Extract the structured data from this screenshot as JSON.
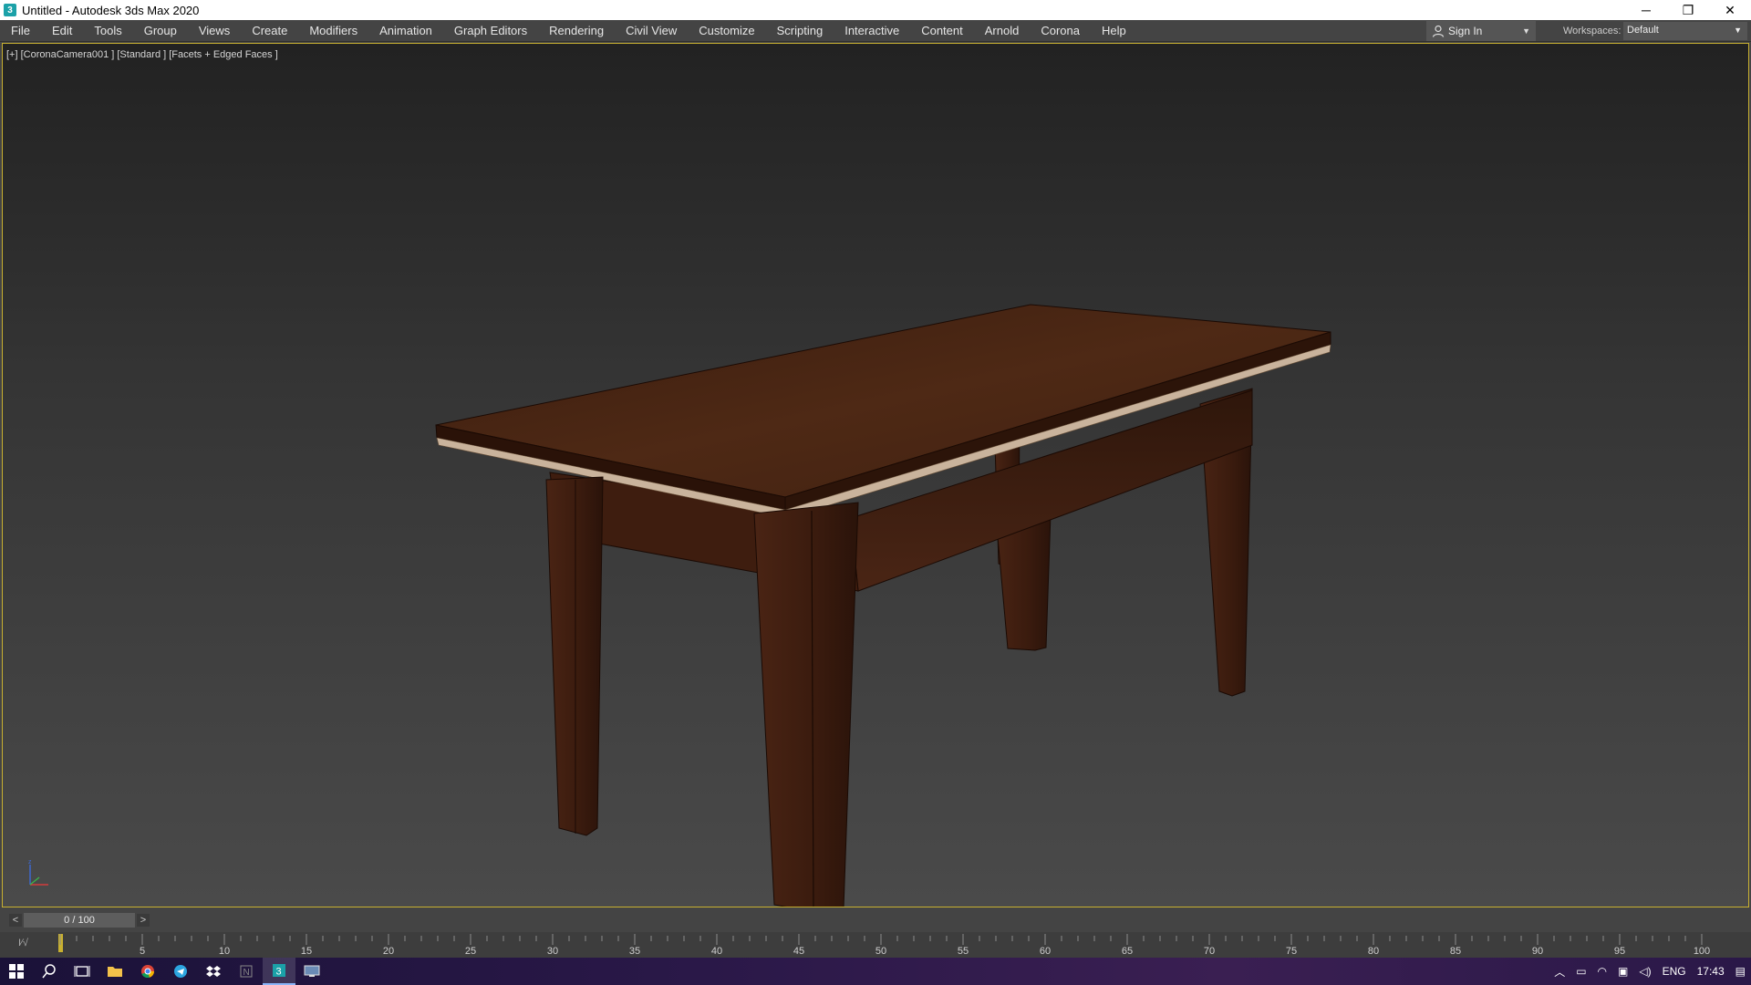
{
  "window": {
    "title": "Untitled - Autodesk 3ds Max 2020",
    "app_icon": "3",
    "controls": {
      "minimize": "─",
      "restore": "❐",
      "close": "✕"
    }
  },
  "menu": [
    "File",
    "Edit",
    "Tools",
    "Group",
    "Views",
    "Create",
    "Modifiers",
    "Animation",
    "Graph Editors",
    "Rendering",
    "Civil View",
    "Customize",
    "Scripting",
    "Interactive",
    "Content",
    "Arnold",
    "Corona",
    "Help"
  ],
  "account": {
    "sign_in_label": "Sign In",
    "caret": "▼"
  },
  "workspace": {
    "label": "Workspaces:",
    "value": "Default",
    "caret": "▼"
  },
  "viewport": {
    "label": "[+] [CoronaCamera001 ] [Standard ] [Facets + Edged Faces ]",
    "scene_object": "wooden-table",
    "border_color": "#c8b030"
  },
  "time_slider": {
    "value": "0 / 100",
    "prev": "<",
    "next": ">"
  },
  "track_bar": {
    "curve_icon": "I∕√",
    "ticks": [
      "5",
      "10",
      "15",
      "20",
      "25",
      "30",
      "35",
      "40",
      "45",
      "50",
      "55",
      "60",
      "65",
      "70",
      "75",
      "80",
      "85",
      "90",
      "95",
      "100"
    ]
  },
  "taskbar": {
    "icons": [
      "windows-start-icon",
      "search-icon",
      "task-view-icon",
      "file-explorer-icon",
      "chrome-icon",
      "telegram-icon",
      "dropbox-icon",
      "notion-icon",
      "3dsmax-icon",
      "remote-desktop-icon"
    ],
    "tray": {
      "language": "ENG",
      "time": "17:43"
    }
  },
  "colors": {
    "menubar": "#444444",
    "accent": "#c8b030",
    "wood_top": "#4a2614",
    "wood_leg": "#3d1d10"
  }
}
